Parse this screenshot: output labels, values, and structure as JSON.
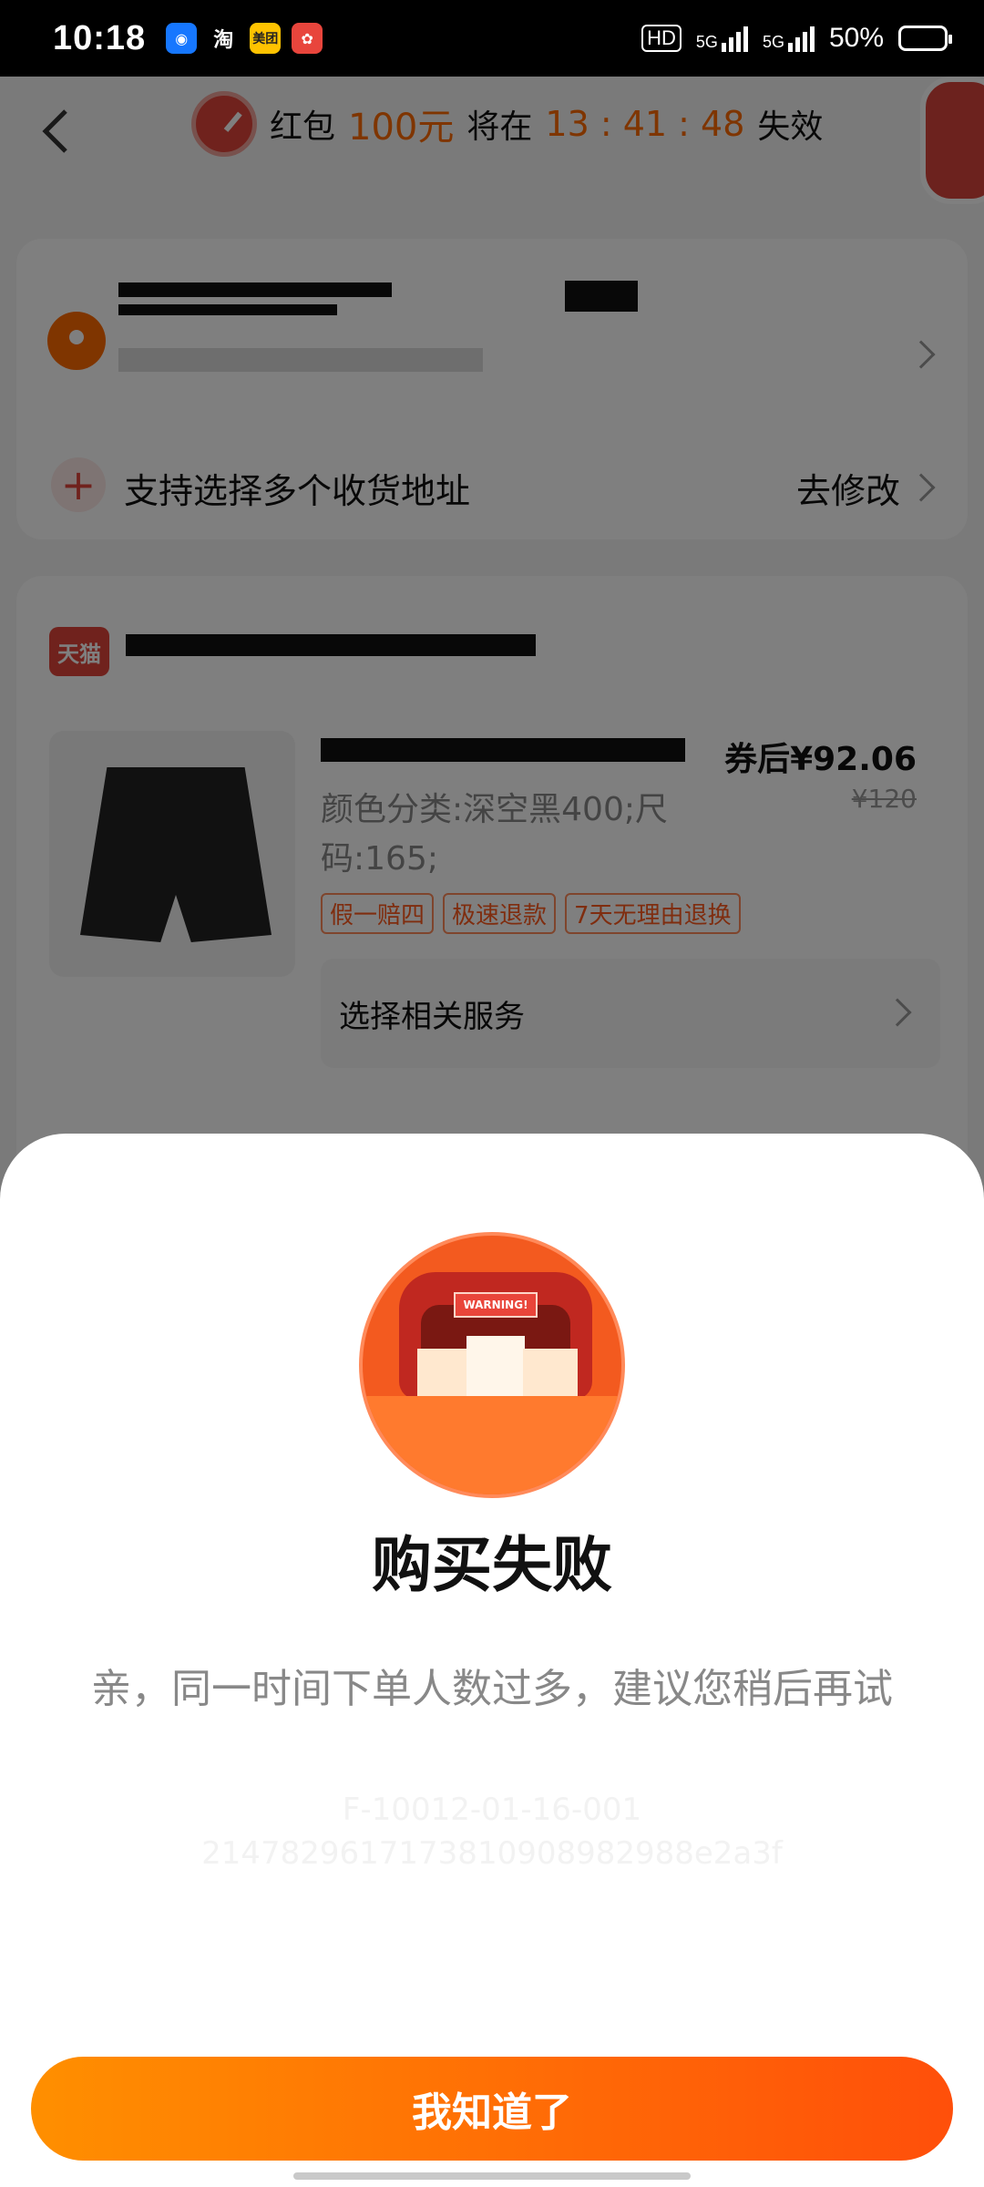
{
  "status_bar": {
    "time": "10:18",
    "apps": [
      {
        "icon": "robot-icon",
        "label": "",
        "color": "#1677ff"
      },
      {
        "icon": "taobao-icon",
        "label": "淘",
        "color": "#000000"
      },
      {
        "icon": "meituan-icon",
        "label": "美团",
        "color": "#ffc300"
      },
      {
        "icon": "app-icon",
        "label": "",
        "color": "#e8453c"
      }
    ],
    "hd_label": "HD",
    "network_1": "5G",
    "network_2": "5G",
    "battery_text": "50%",
    "battery_level": 0.5
  },
  "header": {
    "timer_prefix": "红包",
    "amount": "100元",
    "timer_mid": "将在",
    "countdown": "13 : 41 : 48",
    "timer_suffix": "失效"
  },
  "address": {
    "multi_label": "支持选择多个收货地址",
    "edit_label": "去修改"
  },
  "shop": {
    "badge": "天猫",
    "price": "券后¥92.06",
    "original_price": "¥120",
    "spec": "颜色分类:深空黑400;尺码:165;",
    "tags": [
      "假一赔四",
      "极速退款",
      "7天无理由退换"
    ],
    "service_label": "选择相关服务"
  },
  "dialog": {
    "title": "购买失败",
    "message": "亲，同一时间下单人数过多，建议您稍后再试",
    "error_code": "F-10012-01-16-001",
    "trace_id": "2147829617173810908982988e2a3f",
    "hero_text": "WARNING!",
    "confirm_label": "我知道了"
  },
  "colors": {
    "accent": "#ff6a00",
    "button_start": "#ff8f00",
    "button_end": "#ff4f0a"
  }
}
